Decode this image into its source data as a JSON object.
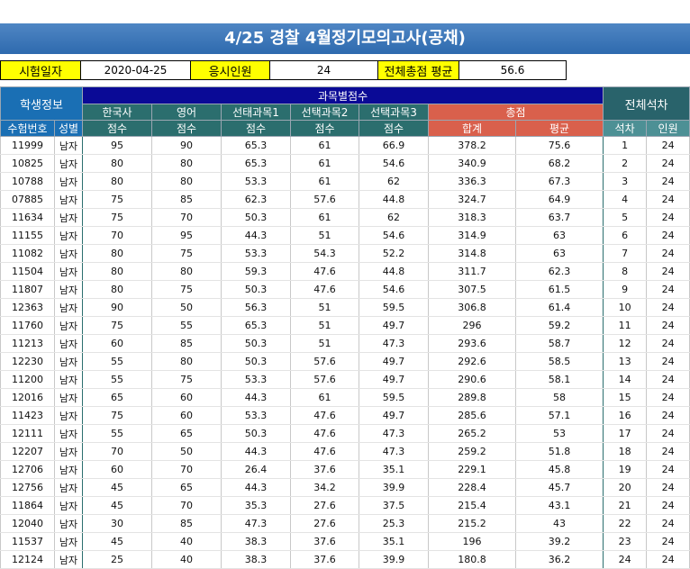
{
  "title": "4/25 경찰 4월정기모의고사(공채)",
  "info": {
    "exam_date_label": "시험일자",
    "exam_date": "2020-04-25",
    "applicants_label": "응시인원",
    "applicants": "24",
    "avg_label": "전체총점 평균",
    "avg": "56.6"
  },
  "headers": {
    "student_info": "학생정보",
    "subject_scores": "과목별점수",
    "overall_rank": "전체석차",
    "korean_history": "한국사",
    "english": "영어",
    "elective1": "선태과목1",
    "elective2": "선택과목2",
    "elective3": "선택과목3",
    "total_score": "총점",
    "exam_no": "수험번호",
    "gender": "성별",
    "score1": "점수",
    "score2": "점수",
    "score3": "점수",
    "score4": "점수",
    "score5": "점수",
    "sum": "합계",
    "average": "평균",
    "rank": "석차",
    "headcount": "인원"
  },
  "rows": [
    [
      "11999",
      "남자",
      "95",
      "90",
      "65.3",
      "61",
      "66.9",
      "378.2",
      "75.6",
      "1",
      "24"
    ],
    [
      "10825",
      "남자",
      "80",
      "80",
      "65.3",
      "61",
      "54.6",
      "340.9",
      "68.2",
      "2",
      "24"
    ],
    [
      "10788",
      "남자",
      "80",
      "80",
      "53.3",
      "61",
      "62",
      "336.3",
      "67.3",
      "3",
      "24"
    ],
    [
      "07885",
      "남자",
      "75",
      "85",
      "62.3",
      "57.6",
      "44.8",
      "324.7",
      "64.9",
      "4",
      "24"
    ],
    [
      "11634",
      "남자",
      "75",
      "70",
      "50.3",
      "61",
      "62",
      "318.3",
      "63.7",
      "5",
      "24"
    ],
    [
      "11155",
      "남자",
      "70",
      "95",
      "44.3",
      "51",
      "54.6",
      "314.9",
      "63",
      "6",
      "24"
    ],
    [
      "11082",
      "남자",
      "80",
      "75",
      "53.3",
      "54.3",
      "52.2",
      "314.8",
      "63",
      "7",
      "24"
    ],
    [
      "11504",
      "남자",
      "80",
      "80",
      "59.3",
      "47.6",
      "44.8",
      "311.7",
      "62.3",
      "8",
      "24"
    ],
    [
      "11807",
      "남자",
      "80",
      "75",
      "50.3",
      "47.6",
      "54.6",
      "307.5",
      "61.5",
      "9",
      "24"
    ],
    [
      "12363",
      "남자",
      "90",
      "50",
      "56.3",
      "51",
      "59.5",
      "306.8",
      "61.4",
      "10",
      "24"
    ],
    [
      "11760",
      "남자",
      "75",
      "55",
      "65.3",
      "51",
      "49.7",
      "296",
      "59.2",
      "11",
      "24"
    ],
    [
      "11213",
      "남자",
      "60",
      "85",
      "50.3",
      "51",
      "47.3",
      "293.6",
      "58.7",
      "12",
      "24"
    ],
    [
      "12230",
      "남자",
      "55",
      "80",
      "50.3",
      "57.6",
      "49.7",
      "292.6",
      "58.5",
      "13",
      "24"
    ],
    [
      "11200",
      "남자",
      "55",
      "75",
      "53.3",
      "57.6",
      "49.7",
      "290.6",
      "58.1",
      "14",
      "24"
    ],
    [
      "12016",
      "남자",
      "65",
      "60",
      "44.3",
      "61",
      "59.5",
      "289.8",
      "58",
      "15",
      "24"
    ],
    [
      "11423",
      "남자",
      "75",
      "60",
      "53.3",
      "47.6",
      "49.7",
      "285.6",
      "57.1",
      "16",
      "24"
    ],
    [
      "12111",
      "남자",
      "55",
      "65",
      "50.3",
      "47.6",
      "47.3",
      "265.2",
      "53",
      "17",
      "24"
    ],
    [
      "12207",
      "남자",
      "70",
      "50",
      "44.3",
      "47.6",
      "47.3",
      "259.2",
      "51.8",
      "18",
      "24"
    ],
    [
      "12706",
      "남자",
      "60",
      "70",
      "26.4",
      "37.6",
      "35.1",
      "229.1",
      "45.8",
      "19",
      "24"
    ],
    [
      "12756",
      "남자",
      "45",
      "65",
      "44.3",
      "34.2",
      "39.9",
      "228.4",
      "45.7",
      "20",
      "24"
    ],
    [
      "11864",
      "남자",
      "45",
      "70",
      "35.3",
      "27.6",
      "37.5",
      "215.4",
      "43.1",
      "21",
      "24"
    ],
    [
      "12040",
      "남자",
      "30",
      "85",
      "47.3",
      "27.6",
      "25.3",
      "215.2",
      "43",
      "22",
      "24"
    ],
    [
      "11537",
      "남자",
      "45",
      "40",
      "38.3",
      "37.6",
      "35.1",
      "196",
      "39.2",
      "23",
      "24"
    ],
    [
      "12124",
      "남자",
      "25",
      "40",
      "38.3",
      "37.6",
      "39.9",
      "180.8",
      "36.2",
      "24",
      "24"
    ]
  ]
}
